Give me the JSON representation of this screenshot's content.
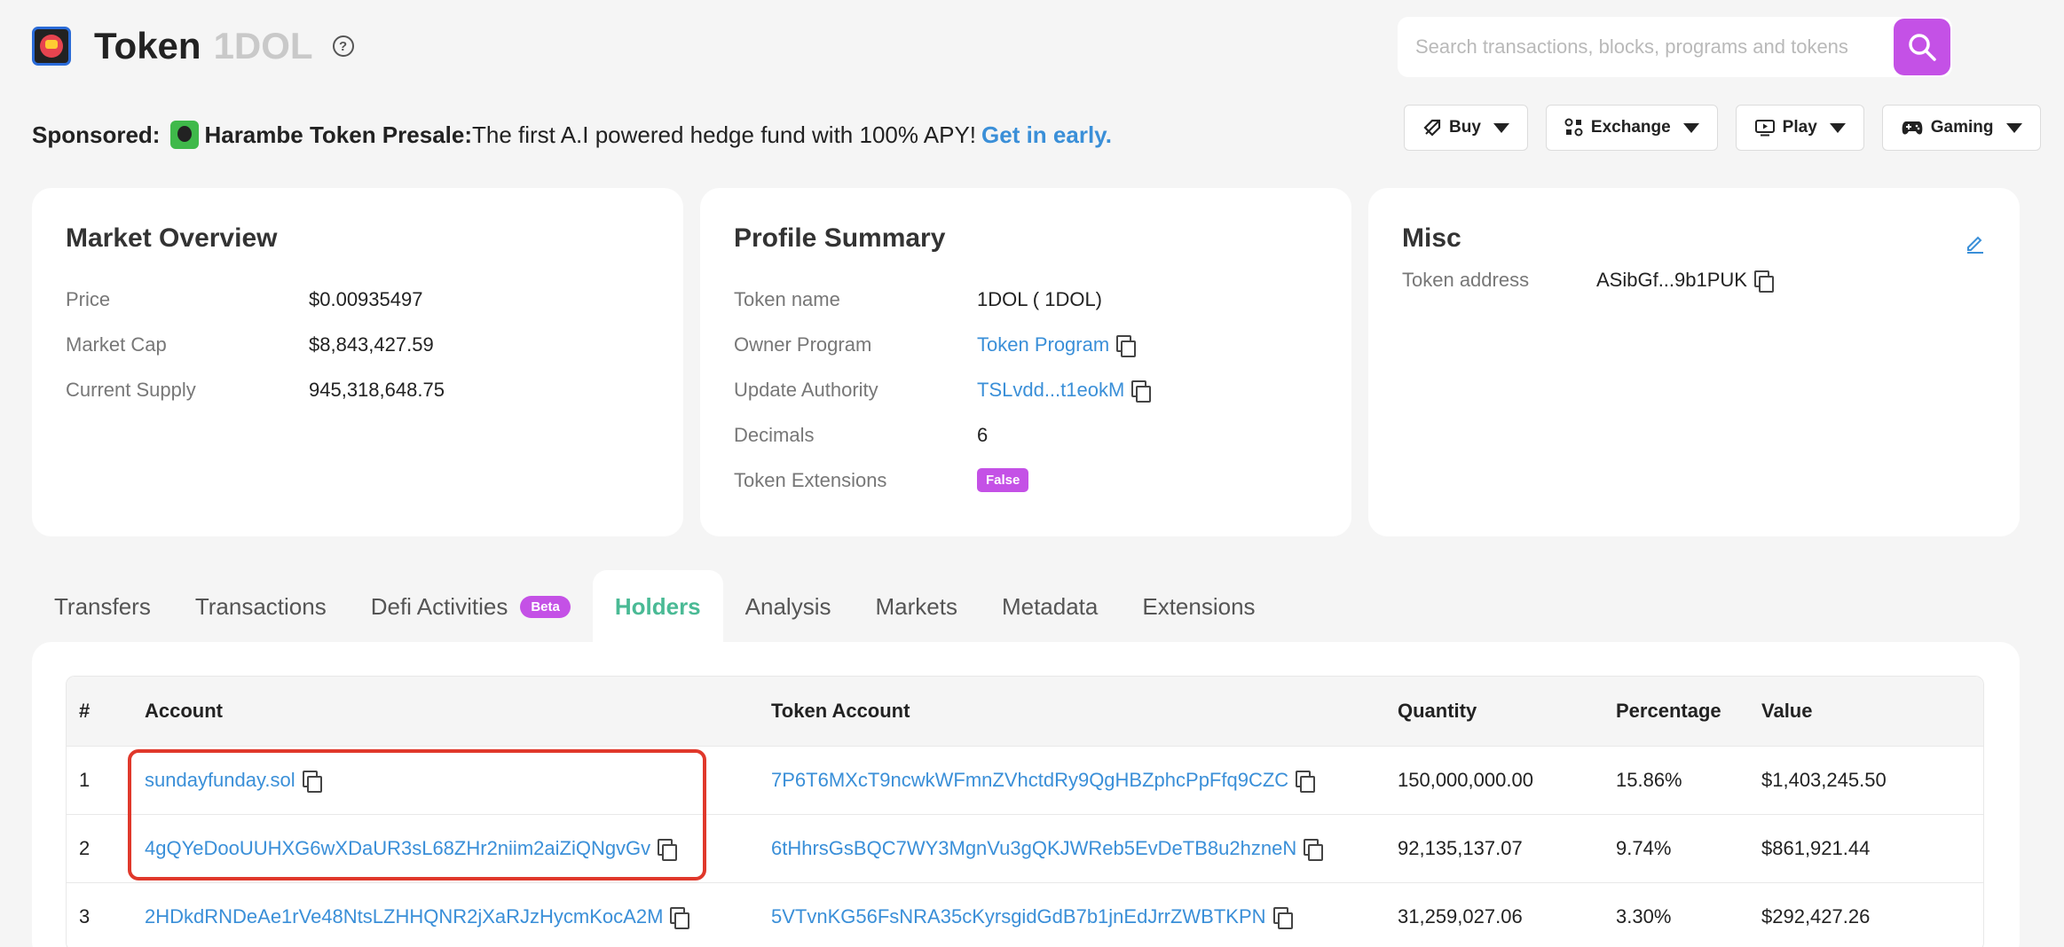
{
  "header": {
    "title": "Token",
    "symbol": "1DOL",
    "help_icon": "question-circle-icon"
  },
  "search": {
    "placeholder": "Search transactions, blocks, programs and tokens",
    "icon": "search-icon"
  },
  "sponsored": {
    "label": "Sponsored:",
    "name": "Harambe Token Presale:",
    "text": "The first A.I powered hedge fund with 100% APY!",
    "link": "Get in early."
  },
  "nav": {
    "buy": "Buy",
    "exchange": "Exchange",
    "play": "Play",
    "gaming": "Gaming"
  },
  "market_overview": {
    "title": "Market Overview",
    "rows": [
      {
        "label": "Price",
        "value": "$0.00935497"
      },
      {
        "label": "Market Cap",
        "value": "$8,843,427.59"
      },
      {
        "label": "Current Supply",
        "value": "945,318,648.75"
      }
    ]
  },
  "profile_summary": {
    "title": "Profile Summary",
    "token_name_label": "Token name",
    "token_name": "1DOL ( 1DOL)",
    "owner_program_label": "Owner Program",
    "owner_program": "Token Program",
    "update_authority_label": "Update Authority",
    "update_authority": "TSLvdd...t1eokM",
    "decimals_label": "Decimals",
    "decimals": "6",
    "token_extensions_label": "Token Extensions",
    "token_extensions": "False"
  },
  "misc": {
    "title": "Misc",
    "token_address_label": "Token address",
    "token_address": "ASibGf...9b1PUK"
  },
  "tabs": [
    {
      "label": "Transfers"
    },
    {
      "label": "Transactions"
    },
    {
      "label": "Defi Activities",
      "badge": "Beta"
    },
    {
      "label": "Holders",
      "active": true
    },
    {
      "label": "Analysis"
    },
    {
      "label": "Markets"
    },
    {
      "label": "Metadata"
    },
    {
      "label": "Extensions"
    }
  ],
  "holders": {
    "columns": [
      "#",
      "Account",
      "Token Account",
      "Quantity",
      "Percentage",
      "Value"
    ],
    "rows": [
      {
        "rank": "1",
        "account": "sundayfunday.sol",
        "token_account": "7P6T6MXcT9ncwkWFmnZVhctdRy9QgHBZphcPpFfq9CZC",
        "quantity": "150,000,000.00",
        "percentage": "15.86%",
        "value": "$1,403,245.50"
      },
      {
        "rank": "2",
        "account": "4gQYeDooUUHXG6wXDaUR3sL68ZHr2niim2aiZiQNgvGv",
        "token_account": "6tHhrsGsBQC7WY3MgnVu3gQKJWReb5EvDeTB8u2hzneN",
        "quantity": "92,135,137.07",
        "percentage": "9.74%",
        "value": "$861,921.44"
      },
      {
        "rank": "3",
        "account": "2HDkdRNDeAe1rVe48NtsLZHHQNR2jXaRJzHycmKocA2M",
        "token_account": "5VTvnKG56FsNRA35cKyrsgidGdB7b1jnEdJrrZWBTKPN",
        "quantity": "31,259,027.06",
        "percentage": "3.30%",
        "value": "$292,427.26"
      }
    ]
  },
  "colors": {
    "accent": "#c451e6",
    "link": "#3a8fd8",
    "active_tab": "#4aba95",
    "highlight": "#e0382b"
  }
}
